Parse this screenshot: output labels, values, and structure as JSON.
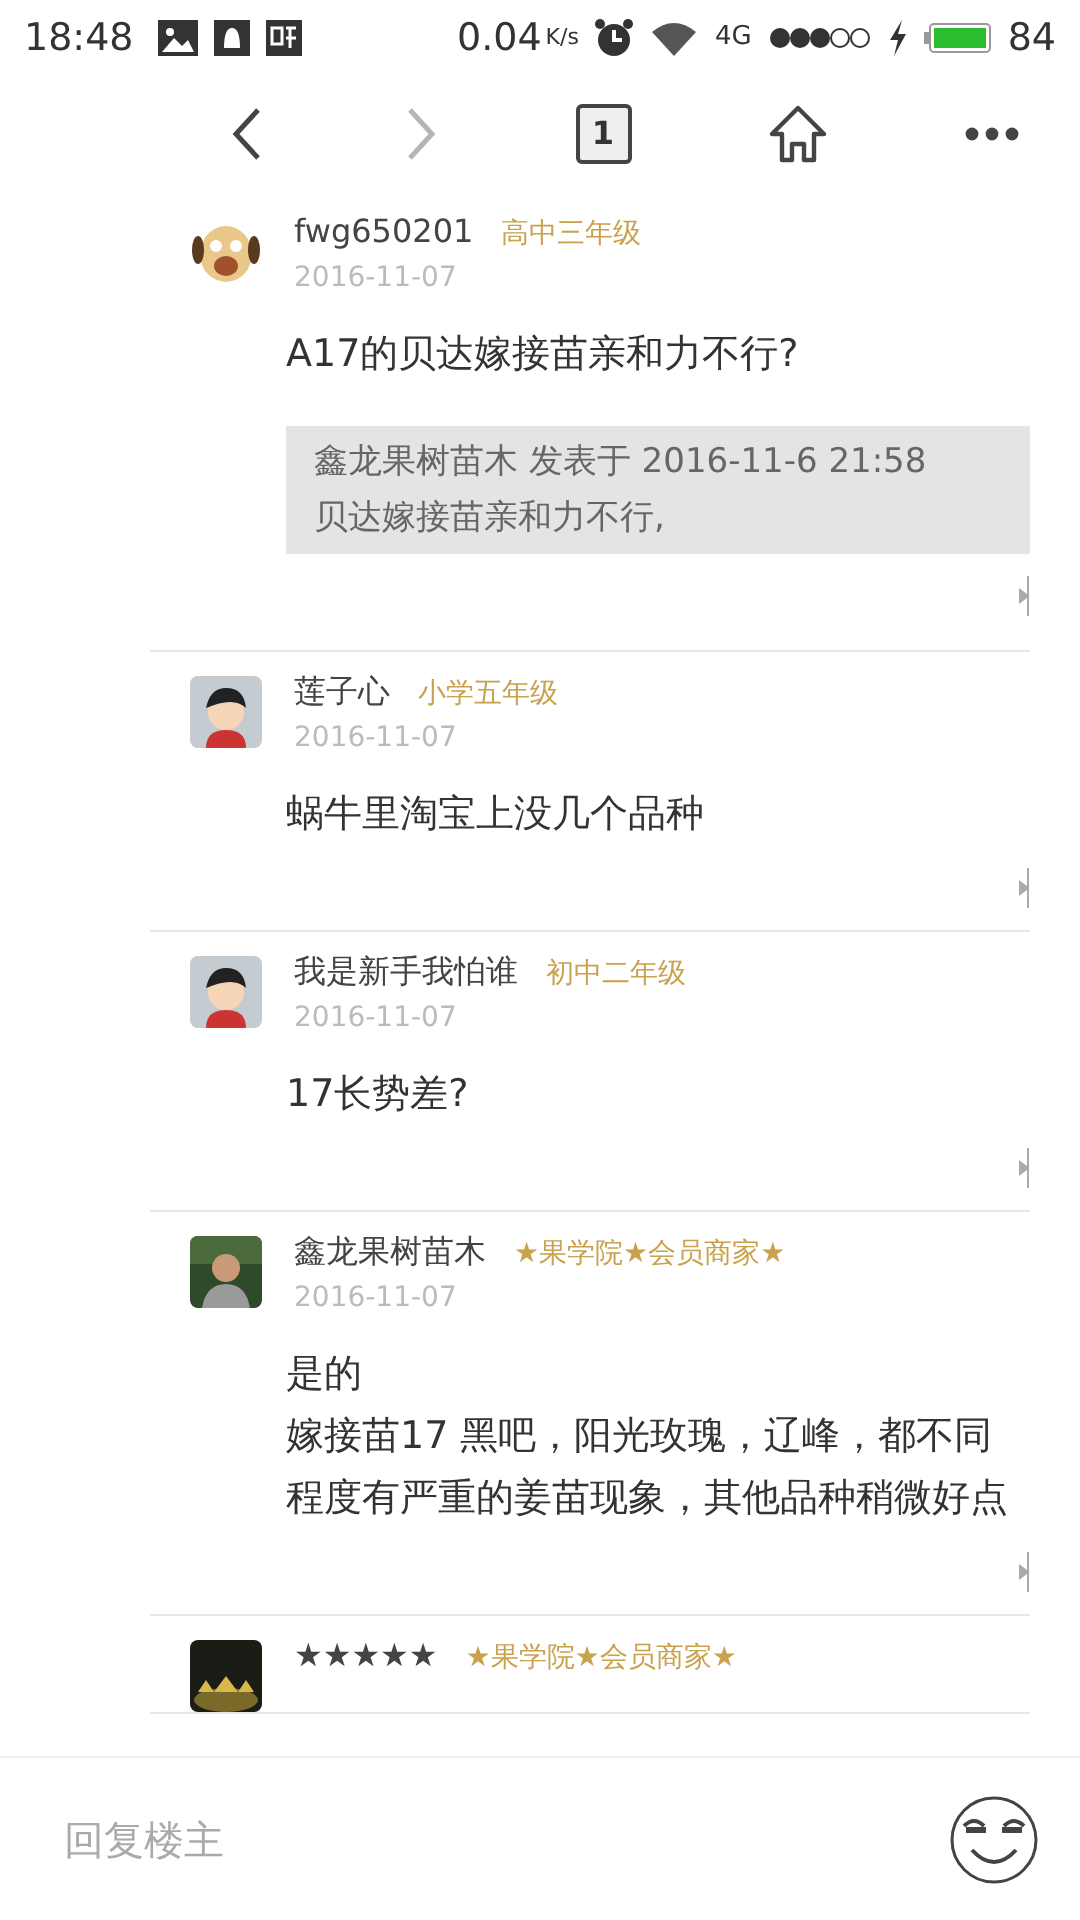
{
  "status_bar": {
    "time": "18:48",
    "speed": "0.04",
    "speed_unit": "K/s",
    "network": "4G",
    "battery": "84"
  },
  "nav": {
    "tab_count": "1",
    "back_disabled": false,
    "forward_disabled": true
  },
  "comments": [
    {
      "avatar": {
        "kind": "dog"
      },
      "username": "fwg650201",
      "grade": "高中三年级",
      "date": "2016-11-07",
      "body": [
        "A17的贝达嫁接苗亲和力不行?"
      ],
      "quote": [
        "鑫龙果树苗木 发表于 2016-11-6 21:58",
        "贝达嫁接苗亲和力不行,"
      ]
    },
    {
      "avatar": {
        "kind": "boy"
      },
      "username": "莲子心",
      "grade": "小学五年级",
      "date": "2016-11-07",
      "body": [
        "蜗牛里淘宝上没几个品种"
      ]
    },
    {
      "avatar": {
        "kind": "boy"
      },
      "username": "我是新手我怕谁",
      "grade": "初中二年级",
      "date": "2016-11-07",
      "body": [
        "17长势差?"
      ]
    },
    {
      "username": "鑫龙果树苗木",
      "grade": "★果学院★会员商家★",
      "date": "2016-11-07",
      "body": [
        "是的",
        "嫁接苗17 黑吧，阳光玫瑰，辽峰，都不同程度有严重的姜苗现象，其他品种稍微好点"
      ]
    },
    {
      "avatar": {
        "kind": "stars"
      },
      "username": "★★★★★",
      "grade": "★果学院★会员商家★"
    }
  ],
  "reply_bar": {
    "placeholder": "回复楼主"
  }
}
